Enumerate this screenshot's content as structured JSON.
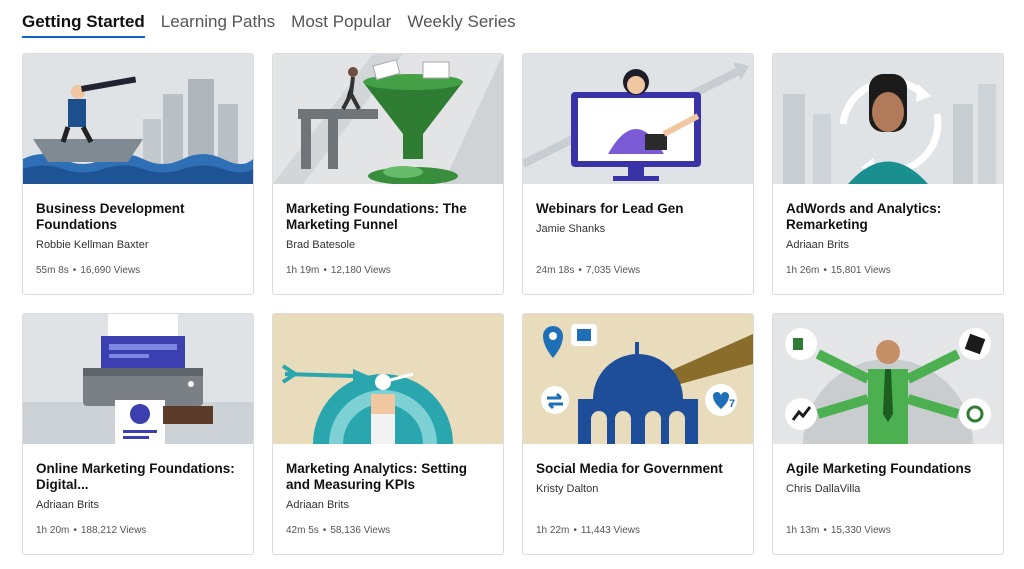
{
  "tabs": [
    {
      "label": "Getting Started",
      "active": true
    },
    {
      "label": "Learning Paths",
      "active": false
    },
    {
      "label": "Most Popular",
      "active": false
    },
    {
      "label": "Weekly Series",
      "active": false
    }
  ],
  "courses": [
    {
      "title": "Business Development Foundations",
      "author": "Robbie Kellman Baxter",
      "duration": "55m 8s",
      "views": "16,690 Views"
    },
    {
      "title": "Marketing Foundations: The Marketing Funnel",
      "author": "Brad Batesole",
      "duration": "1h 19m",
      "views": "12,180 Views"
    },
    {
      "title": "Webinars for Lead Gen",
      "author": "Jamie Shanks",
      "duration": "24m 18s",
      "views": "7,035 Views"
    },
    {
      "title": "AdWords and Analytics: Remarketing",
      "author": "Adriaan Brits",
      "duration": "1h 26m",
      "views": "15,801 Views"
    },
    {
      "title": "Online Marketing Foundations: Digital...",
      "author": "Adriaan Brits",
      "duration": "1h 20m",
      "views": "188,212 Views"
    },
    {
      "title": "Marketing Analytics: Setting and Measuring KPIs",
      "author": "Adriaan Brits",
      "duration": "42m 5s",
      "views": "58,136 Views"
    },
    {
      "title": "Social Media for Government",
      "author": "Kristy Dalton",
      "duration": "1h 22m",
      "views": "11,443 Views"
    },
    {
      "title": "Agile Marketing Foundations",
      "author": "Chris DallaVilla",
      "duration": "1h 13m",
      "views": "15,330 Views"
    }
  ],
  "separator": "•",
  "thumb_badges": {
    "social_likes": "7"
  },
  "colors": {
    "tab_underline": "#0a66c2"
  }
}
